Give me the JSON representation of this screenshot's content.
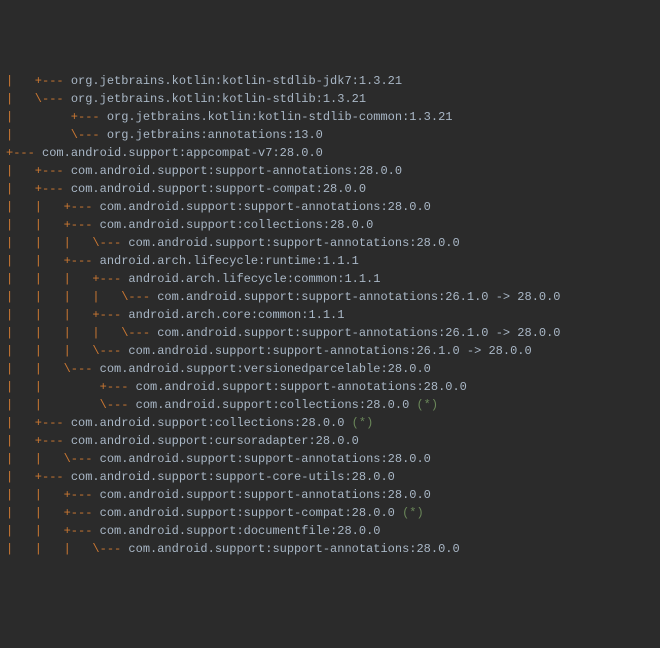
{
  "lines": [
    {
      "tree": "|   +--- ",
      "text": "org.jetbrains.kotlin:kotlin-stdlib-jdk7:1.3.21"
    },
    {
      "tree": "|   \\--- ",
      "text": "org.jetbrains.kotlin:kotlin-stdlib:1.3.21"
    },
    {
      "tree": "|        +--- ",
      "text": "org.jetbrains.kotlin:kotlin-stdlib-common:1.3.21"
    },
    {
      "tree": "|        \\--- ",
      "text": "org.jetbrains:annotations:13.0"
    },
    {
      "tree": "+--- ",
      "text": "com.android.support:appcompat-v7:28.0.0"
    },
    {
      "tree": "|   +--- ",
      "text": "com.android.support:support-annotations:28.0.0"
    },
    {
      "tree": "|   +--- ",
      "text": "com.android.support:support-compat:28.0.0"
    },
    {
      "tree": "|   |   +--- ",
      "text": "com.android.support:support-annotations:28.0.0"
    },
    {
      "tree": "|   |   +--- ",
      "text": "com.android.support:collections:28.0.0"
    },
    {
      "tree": "|   |   |   \\--- ",
      "text": "com.android.support:support-annotations:28.0.0"
    },
    {
      "tree": "|   |   +--- ",
      "text": "android.arch.lifecycle:runtime:1.1.1"
    },
    {
      "tree": "|   |   |   +--- ",
      "text": "android.arch.lifecycle:common:1.1.1"
    },
    {
      "tree": "|   |   |   |   \\--- ",
      "text": "com.android.support:support-annotations:26.1.0 -> 28.0.0"
    },
    {
      "tree": "|   |   |   +--- ",
      "text": "android.arch.core:common:1.1.1"
    },
    {
      "tree": "|   |   |   |   \\--- ",
      "text": "com.android.support:support-annotations:26.1.0 -> 28.0.0"
    },
    {
      "tree": "|   |   |   \\--- ",
      "text": "com.android.support:support-annotations:26.1.0 -> 28.0.0"
    },
    {
      "tree": "|   |   \\--- ",
      "text": "com.android.support:versionedparcelable:28.0.0"
    },
    {
      "tree": "|   |        +--- ",
      "text": "com.android.support:support-annotations:28.0.0"
    },
    {
      "tree": "|   |        \\--- ",
      "text": "com.android.support:collections:28.0.0",
      "marker": " (*)"
    },
    {
      "tree": "|   +--- ",
      "text": "com.android.support:collections:28.0.0",
      "marker": " (*)"
    },
    {
      "tree": "|   +--- ",
      "text": "com.android.support:cursoradapter:28.0.0"
    },
    {
      "tree": "|   |   \\--- ",
      "text": "com.android.support:support-annotations:28.0.0"
    },
    {
      "tree": "|   +--- ",
      "text": "com.android.support:support-core-utils:28.0.0"
    },
    {
      "tree": "|   |   +--- ",
      "text": "com.android.support:support-annotations:28.0.0"
    },
    {
      "tree": "|   |   +--- ",
      "text": "com.android.support:support-compat:28.0.0",
      "marker": " (*)"
    },
    {
      "tree": "|   |   +--- ",
      "text": "com.android.support:documentfile:28.0.0"
    },
    {
      "tree": "|   |   |   \\--- ",
      "text": "com.android.support:support-annotations:28.0.0"
    }
  ]
}
